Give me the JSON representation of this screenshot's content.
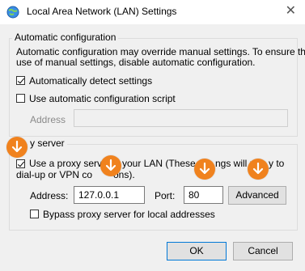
{
  "window": {
    "title": "Local Area Network (LAN) Settings",
    "close_glyph": "✕"
  },
  "auto_config": {
    "legend": "Automatic configuration",
    "description_line1": "Automatic configuration may override manual settings.  To ensure the",
    "description_line2": "use of manual settings, disable automatic configuration.",
    "detect_label": "Automatically detect settings",
    "detect_checked": true,
    "script_label": "Use automatic configuration script",
    "script_checked": false,
    "address_label": "Address",
    "address_value": ""
  },
  "proxy": {
    "legend_visible": "y server",
    "use_proxy_checked": true,
    "use_proxy_line1_a": "Use a proxy serve",
    "use_proxy_line1_b": "your LAN (These set",
    "use_proxy_line1_c": "ngs will not",
    "use_proxy_line1_d": "y to",
    "use_proxy_line2_a": "dial-up or VPN co",
    "use_proxy_line2_b": "ons).",
    "address_label": "Address:",
    "address_value": "127.0.0.1",
    "port_label": "Port:",
    "port_value": "80",
    "advanced_label": "Advanced",
    "bypass_label": "Bypass proxy server for local addresses",
    "bypass_checked": false
  },
  "buttons": {
    "ok": "OK",
    "cancel": "Cancel"
  },
  "colors": {
    "marker": "#f0821e",
    "default_button_border": "#0078d7"
  },
  "icons": {
    "app": "network-globe-icon",
    "marker": "arrow-down-icon"
  }
}
